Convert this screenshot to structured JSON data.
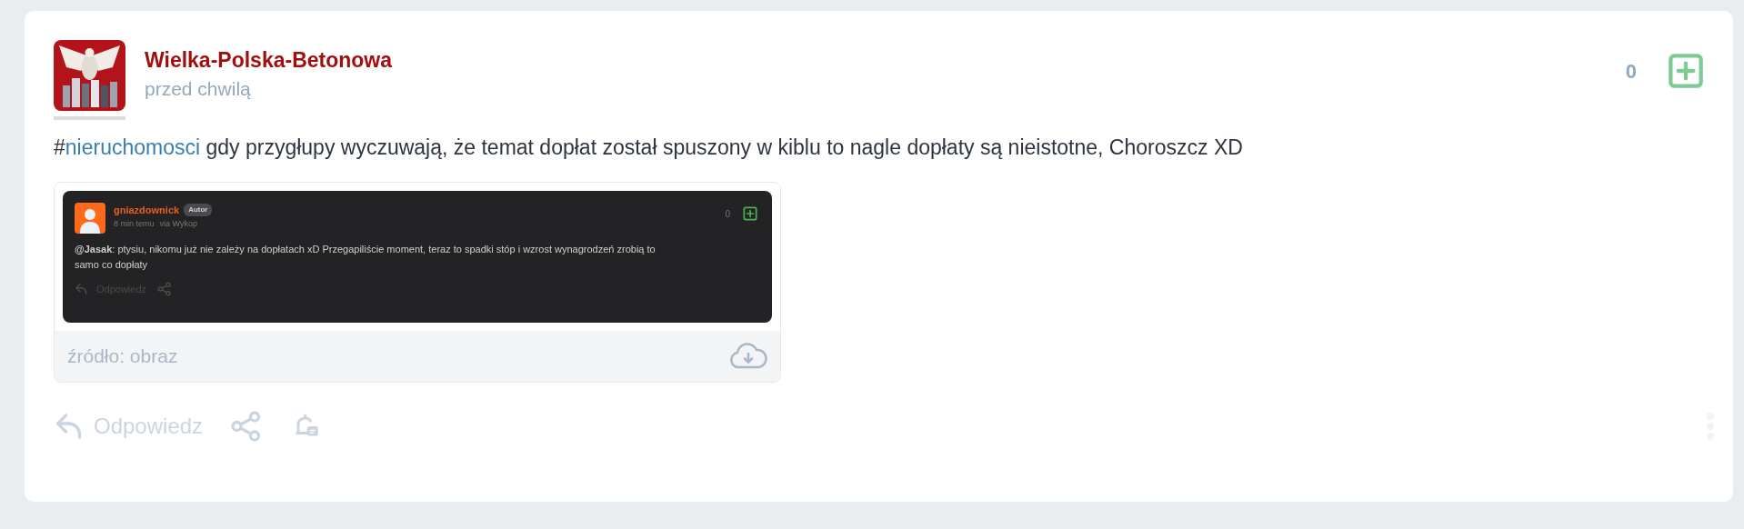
{
  "post": {
    "author": "Wielka-Polska-Betonowa",
    "time": "przed chwilą",
    "votes": "0",
    "tag_prefix": "#",
    "tag": "nieruchomosci",
    "text": "gdy przygłupy wyczuwają, że temat dopłat został spuszony w kiblu to nagle dopłaty są nieistotne, Choroszcz XD",
    "attachment": {
      "screenshot": {
        "author": "gniazdownick",
        "badge": "Autor",
        "time": "8 min temu",
        "via": "via Wykop",
        "votes": "0",
        "text": "**@Jasak**: ptysiu, nikomu już nie zależy na dopłatach xD Przegapiliście moment, teraz to spadki stóp i wzrost wynagrodzeń zrobią to samo co dopłaty",
        "actions": [
          {
            "kind": "reply",
            "label": "Odpowiedz"
          },
          {
            "kind": "share"
          }
        ]
      },
      "source": "źródło: obraz"
    },
    "actions": [
      {
        "kind": "reply",
        "label": "Odpowiedz"
      },
      {
        "kind": "share"
      },
      {
        "kind": "notify"
      }
    ]
  }
}
